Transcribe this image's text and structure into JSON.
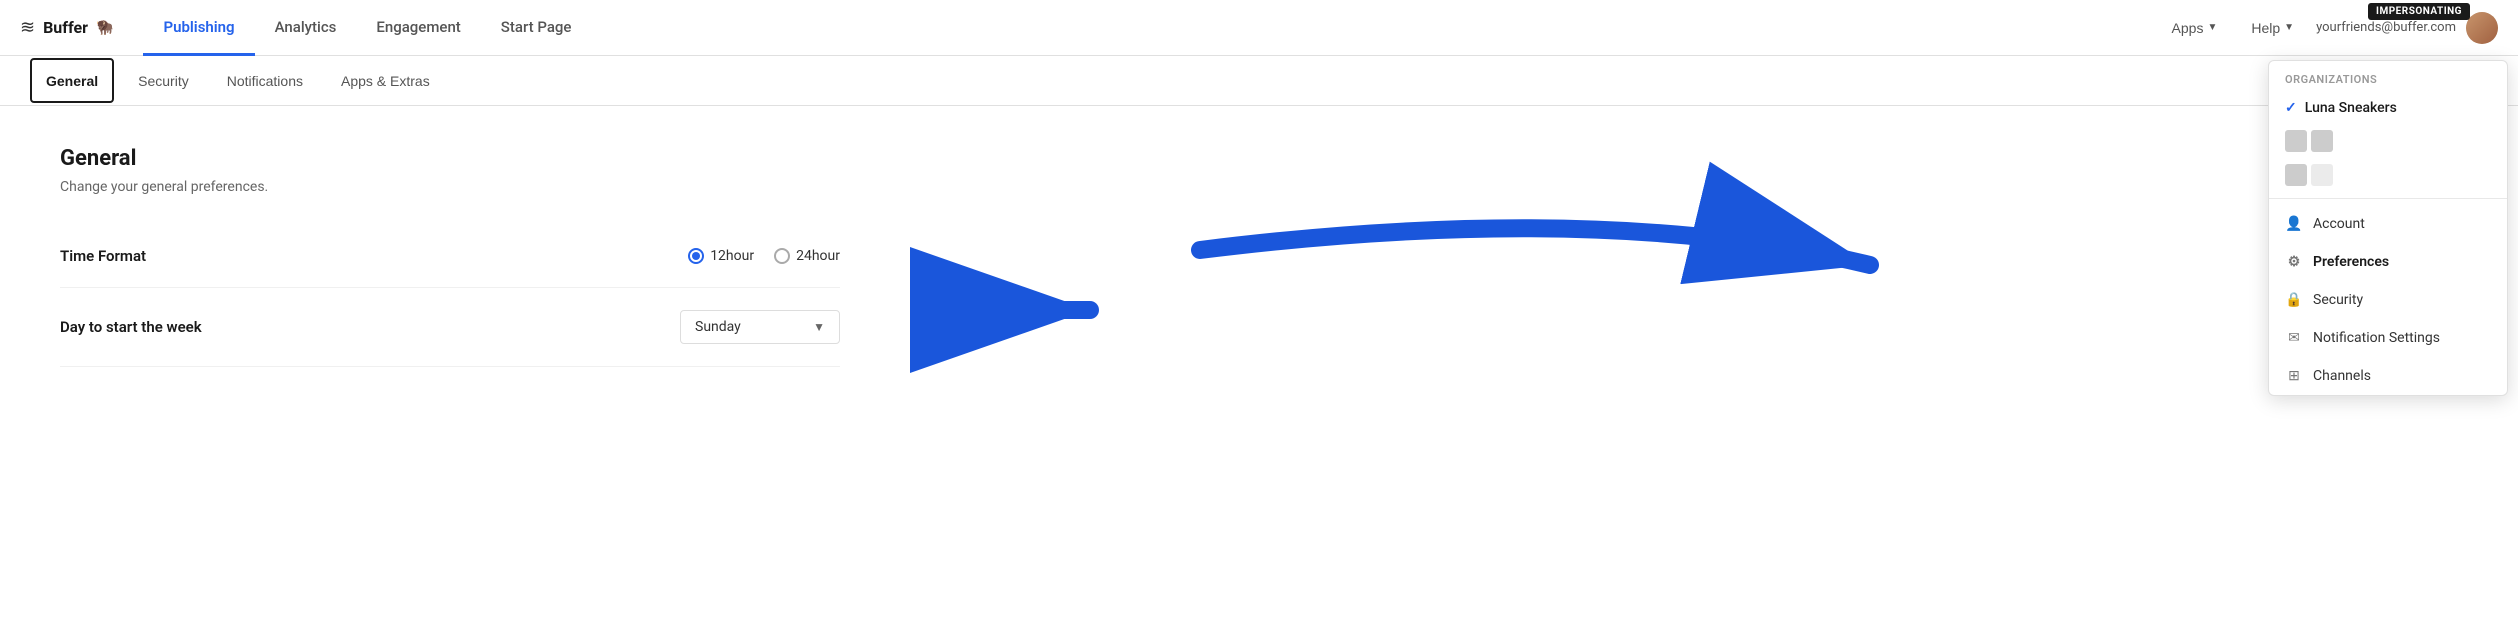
{
  "app": {
    "logo_text": "Buffer",
    "logo_emoji": "🦬"
  },
  "top_nav": {
    "tabs": [
      {
        "id": "publishing",
        "label": "Publishing",
        "active": true
      },
      {
        "id": "analytics",
        "label": "Analytics",
        "active": false
      },
      {
        "id": "engagement",
        "label": "Engagement",
        "active": false
      },
      {
        "id": "start_page",
        "label": "Start Page",
        "active": false
      }
    ],
    "apps_label": "Apps",
    "help_label": "Help",
    "user_email": "yourfriends@buffer.com",
    "impersonating_label": "IMPERSONATING"
  },
  "sub_nav": {
    "tabs": [
      {
        "id": "general",
        "label": "General",
        "active": true
      },
      {
        "id": "security",
        "label": "Security",
        "active": false
      },
      {
        "id": "notifications",
        "label": "Notifications",
        "active": false
      },
      {
        "id": "apps_extras",
        "label": "Apps & Extras",
        "active": false
      }
    ]
  },
  "main": {
    "section_title": "General",
    "section_desc": "Change your general preferences.",
    "settings": [
      {
        "id": "time_format",
        "label": "Time Format",
        "type": "radio",
        "options": [
          {
            "value": "12hour",
            "label": "12hour",
            "selected": true
          },
          {
            "value": "24hour",
            "label": "24hour",
            "selected": false
          }
        ]
      },
      {
        "id": "day_start",
        "label": "Day to start the week",
        "type": "select",
        "value": "Sunday"
      }
    ]
  },
  "dropdown_menu": {
    "organizations_label": "Organizations",
    "org_name": "Luna Sneakers",
    "menu_items": [
      {
        "id": "account",
        "label": "Account",
        "icon": "person"
      },
      {
        "id": "preferences",
        "label": "Preferences",
        "icon": "gear",
        "active": true
      },
      {
        "id": "security",
        "label": "Security",
        "icon": "lock"
      },
      {
        "id": "notification_settings",
        "label": "Notification Settings",
        "icon": "envelope"
      },
      {
        "id": "channels",
        "label": "Channels",
        "icon": "grid"
      }
    ]
  }
}
